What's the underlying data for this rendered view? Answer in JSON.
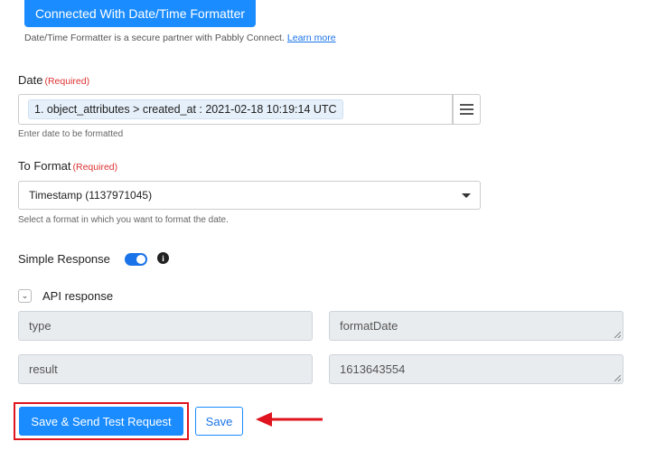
{
  "header": {
    "connected_label": "Connected With Date/Time Formatter",
    "partner_note": "Date/Time Formatter is a secure partner with Pabbly Connect.",
    "learn_more": "Learn more"
  },
  "date_field": {
    "label": "Date",
    "required": "(Required)",
    "value_chip": "1. object_attributes > created_at : 2021-02-18 10:19:14 UTC",
    "help": "Enter date to be formatted"
  },
  "format_field": {
    "label": "To Format",
    "required": "(Required)",
    "selected": "Timestamp (1137971045)",
    "help": "Select a format in which you want to format the date."
  },
  "simple_response": {
    "label": "Simple Response",
    "enabled": true
  },
  "api_response": {
    "label": "API response",
    "rows": [
      {
        "key": "type",
        "value": "formatDate"
      },
      {
        "key": "result",
        "value": "1613643554"
      }
    ]
  },
  "actions": {
    "primary_label": "Save & Send Test Request",
    "save_label": "Save"
  },
  "colors": {
    "primary": "#1a8cff",
    "highlight": "#e0141e"
  }
}
